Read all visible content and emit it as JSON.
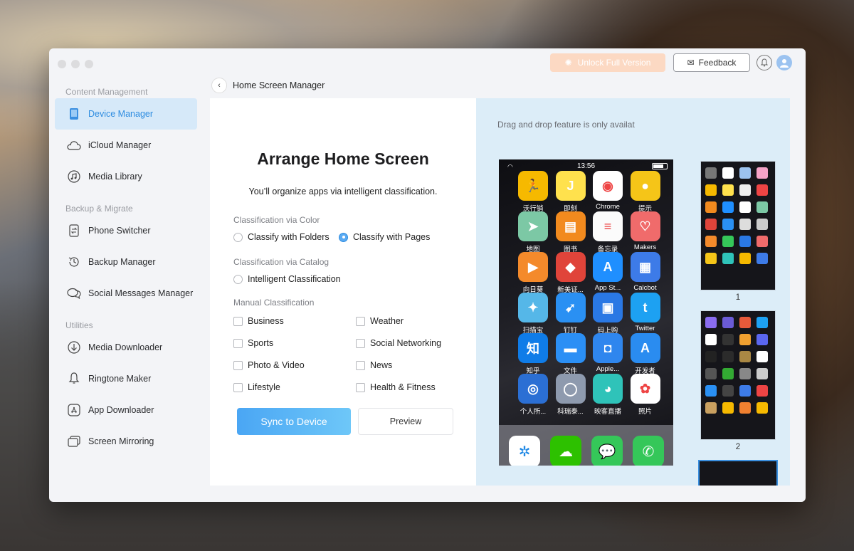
{
  "window": {
    "unlock_label": "Unlock Full Version",
    "feedback_label": "Feedback"
  },
  "sidebar": {
    "sections": [
      {
        "title": "Content Management",
        "items": [
          {
            "label": "Device Manager",
            "icon": "ipad-icon",
            "active": true
          },
          {
            "label": "iCloud Manager",
            "icon": "cloud-icon"
          },
          {
            "label": "Media Library",
            "icon": "music-icon"
          }
        ]
      },
      {
        "title": "Backup & Migrate",
        "items": [
          {
            "label": "Phone Switcher",
            "icon": "phone-switch-icon"
          },
          {
            "label": "Backup Manager",
            "icon": "backup-clock-icon"
          },
          {
            "label": "Social Messages Manager",
            "icon": "chat-bubbles-icon"
          }
        ]
      },
      {
        "title": "Utilities",
        "items": [
          {
            "label": "Media Downloader",
            "icon": "download-icon"
          },
          {
            "label": "Ringtone Maker",
            "icon": "bell-icon"
          },
          {
            "label": "App Downloader",
            "icon": "app-store-icon"
          },
          {
            "label": "Screen Mirroring",
            "icon": "mirror-icon"
          }
        ]
      }
    ]
  },
  "breadcrumb": {
    "title": "Home Screen Manager"
  },
  "arrange": {
    "heading": "Arrange Home Screen",
    "subtitle": "You’ll organize apps via intelligent classification.",
    "color_label": "Classification via Color",
    "folders_label": "Classify with Folders",
    "pages_label": "Classify with Pages",
    "selected": "pages",
    "catalog_label": "Classification via Catalog",
    "intelligent_label": "Intelligent Classification",
    "manual_label": "Manual Classification",
    "categories": [
      "Business",
      "Weather",
      "Sports",
      "Social Networking",
      "Photo & Video",
      "News",
      "Lifestyle",
      "Health & Fitness"
    ],
    "sync_label": "Sync to Device",
    "preview_label": "Preview"
  },
  "preview": {
    "drag_note": "Drag and drop feature is only availat",
    "time": "13:56",
    "apps": [
      {
        "name": "沃行销",
        "color": "#f6b900",
        "glyph": "🏃"
      },
      {
        "name": "即刻",
        "color": "#ffe14d",
        "glyph": "J"
      },
      {
        "name": "Chrome",
        "color": "#ffffff",
        "glyph": "◉"
      },
      {
        "name": "提示",
        "color": "#f5c518",
        "glyph": "●"
      },
      {
        "name": "地图",
        "color": "#7cc8a5",
        "glyph": "➤"
      },
      {
        "name": "图书",
        "color": "#f28a1e",
        "glyph": "▤"
      },
      {
        "name": "备忘录",
        "color": "#fbfbfb",
        "glyph": "≡"
      },
      {
        "name": "Makers",
        "color": "#f06b6b",
        "glyph": "♡"
      },
      {
        "name": "向日葵",
        "color": "#f48a2b",
        "glyph": "▶"
      },
      {
        "name": "新美证...",
        "color": "#e0443a",
        "glyph": "◆"
      },
      {
        "name": "App St...",
        "color": "#1f8fff",
        "glyph": "A"
      },
      {
        "name": "Calcbot",
        "color": "#3d7be8",
        "glyph": "▦"
      },
      {
        "name": "扫描宝",
        "color": "#55b7e8",
        "glyph": "✦"
      },
      {
        "name": "钉钉",
        "color": "#2a90f3",
        "glyph": "➹"
      },
      {
        "name": "码上购",
        "color": "#2a78e4",
        "glyph": "▣"
      },
      {
        "name": "Twitter",
        "color": "#1da1f2",
        "glyph": "t"
      },
      {
        "name": "知乎",
        "color": "#0f7ce8",
        "glyph": "知"
      },
      {
        "name": "文件",
        "color": "#2b8ff5",
        "glyph": "▬"
      },
      {
        "name": "Apple...",
        "color": "#2f86ee",
        "glyph": "◘"
      },
      {
        "name": "开发者",
        "color": "#2a8cf0",
        "glyph": "A"
      },
      {
        "name": "个人所...",
        "color": "#2b6fd4",
        "glyph": "◎"
      },
      {
        "name": "科瑞泰...",
        "color": "#8e9aae",
        "glyph": "◯"
      },
      {
        "name": "映客直播",
        "color": "#2fc3b9",
        "glyph": "◕"
      },
      {
        "name": "照片",
        "color": "#ffffff",
        "glyph": "✿"
      }
    ],
    "dock": [
      {
        "name": "safari",
        "color": "#ffffff",
        "glyph": "✲"
      },
      {
        "name": "wechat",
        "color": "#2dc100",
        "glyph": "☁"
      },
      {
        "name": "messages",
        "color": "#35c759",
        "glyph": "💬"
      },
      {
        "name": "phone",
        "color": "#35c759",
        "glyph": "✆"
      }
    ],
    "pages": [
      "1",
      "2"
    ]
  },
  "colors": {
    "accent": "#2d8ce0",
    "sidebar_active": "#d6e9f9",
    "unlock": "#fcd9c3"
  }
}
